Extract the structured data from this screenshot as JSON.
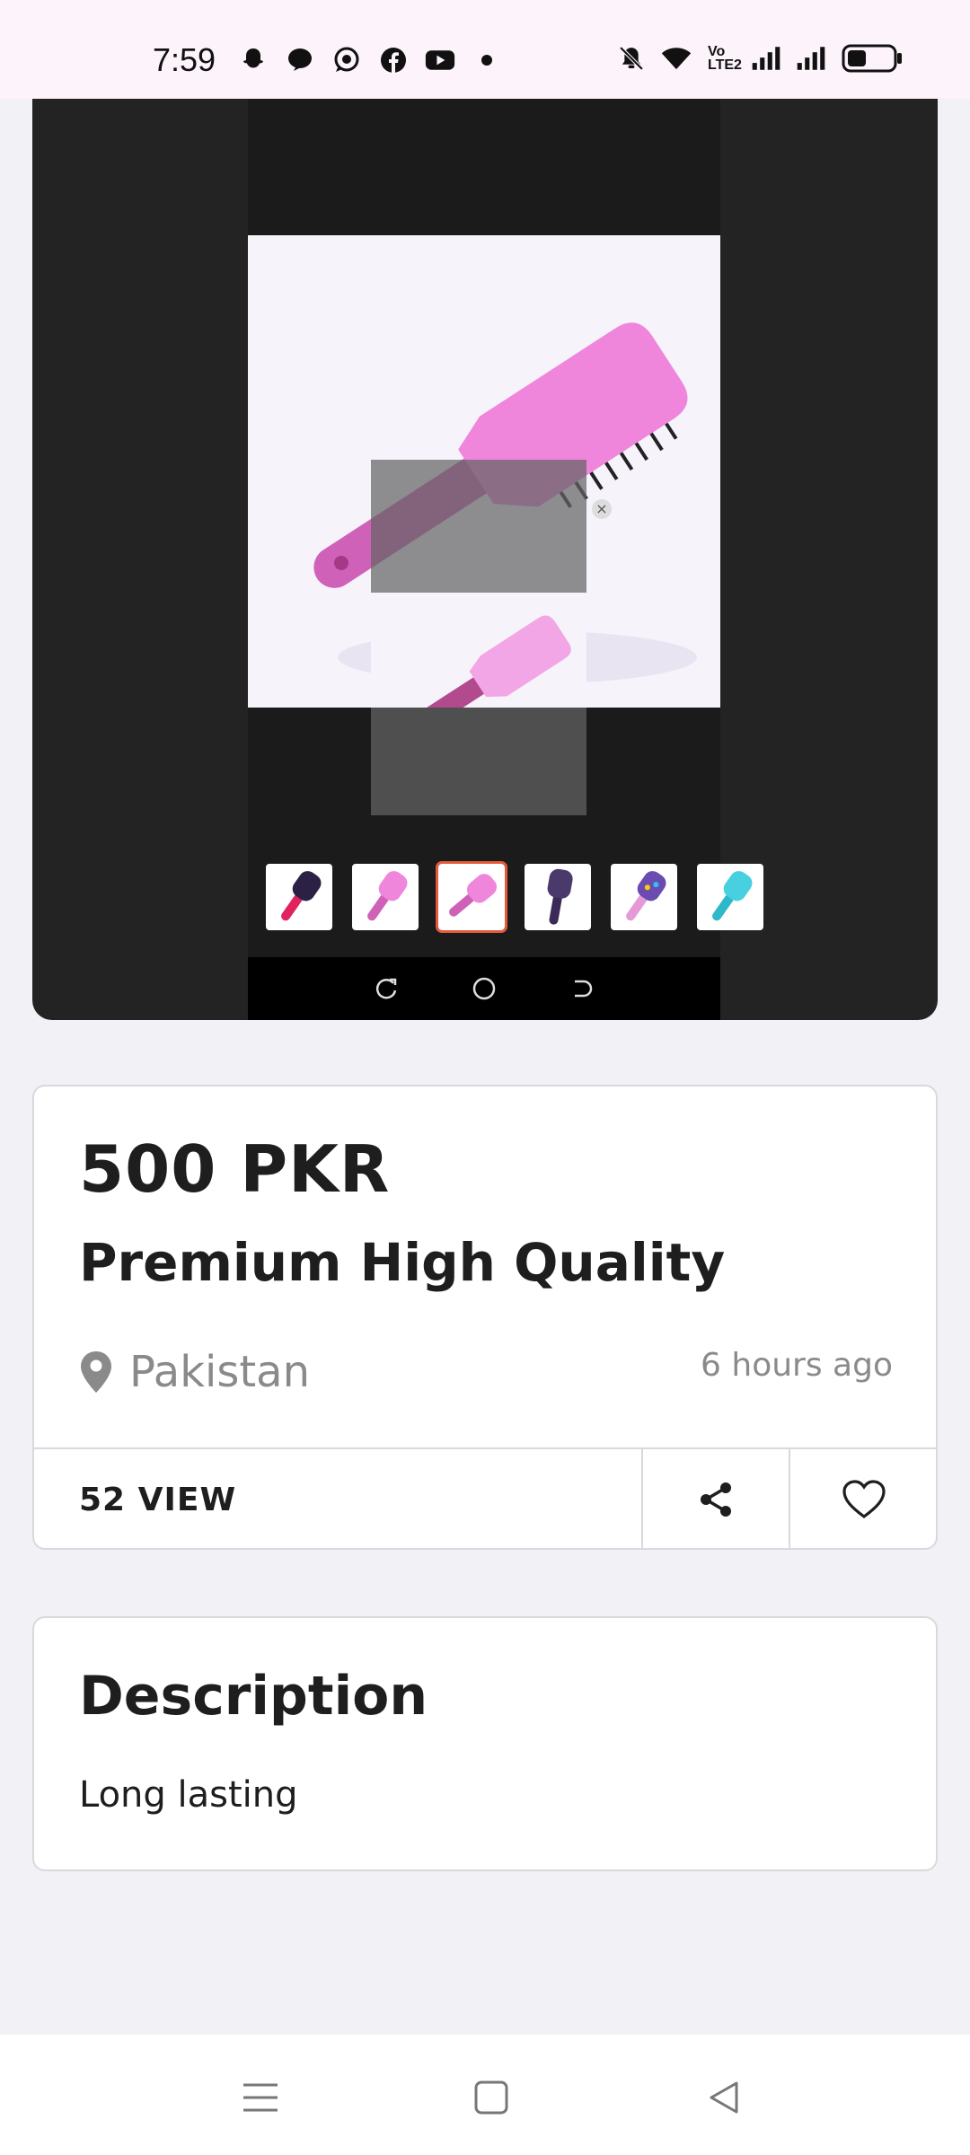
{
  "status_bar": {
    "time": "7:59",
    "left_icons": [
      "snapchat-icon",
      "messenger-icon",
      "whatsapp-icon",
      "facebook-icon",
      "youtube-icon",
      "more-dot"
    ],
    "right_icons": [
      "mute-icon",
      "wifi-icon",
      "volte-icon",
      "signal-icon",
      "signal-icon",
      "battery-icon"
    ],
    "volte_text": "Vo LTE2"
  },
  "gallery": {
    "thumbnail_count": 6,
    "active_thumbnail": 2,
    "close_glyph": "×"
  },
  "product": {
    "price": "500 PKR",
    "title": "Premium High Quality",
    "location": "Pakistan",
    "posted": "6 hours ago",
    "views": "52 VIEW"
  },
  "actions": {
    "share_icon": "share-icon",
    "favorite_icon": "heart-icon"
  },
  "description": {
    "heading": "Description",
    "text": "Long lasting"
  },
  "colors": {
    "background": "#f2f2f6",
    "brush_pink": "#ec7fd9",
    "brush_handle": "#c8559e",
    "text_dark": "#1e1e1e",
    "text_muted": "#8a8a8a"
  }
}
